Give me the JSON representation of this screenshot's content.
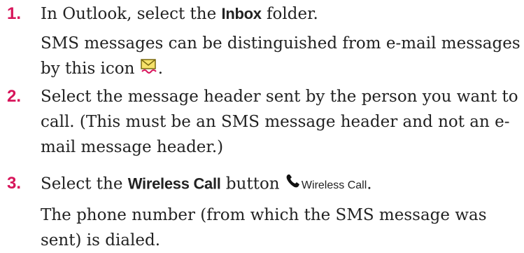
{
  "steps": [
    {
      "number": "1.",
      "line1_pre": "In Outlook, select the ",
      "line1_bold": "Inbox",
      "line1_post": " folder.",
      "note_line1": "SMS messages can be distinguished from e-mail messages",
      "note_line2_pre": "by this icon ",
      "note_line2_post": ".",
      "icon": "sms-envelope-icon"
    },
    {
      "number": "2.",
      "line1": "Select the message header sent by the person you want to",
      "line2": "call. (This must be an SMS message header and not an e-",
      "line3": "mail message header.)"
    },
    {
      "number": "3.",
      "line1_pre": "Select the ",
      "line1_bold": "Wireless Call",
      "line1_post": " button ",
      "button_label": "Wireless Call",
      "button_icon": "phone-handset-icon",
      "line1_end": ".",
      "note_line1": "The phone number (from which the SMS message was",
      "note_line2": "sent) is dialed."
    }
  ],
  "colors": {
    "accent": "#d7145a",
    "text": "#222222"
  }
}
